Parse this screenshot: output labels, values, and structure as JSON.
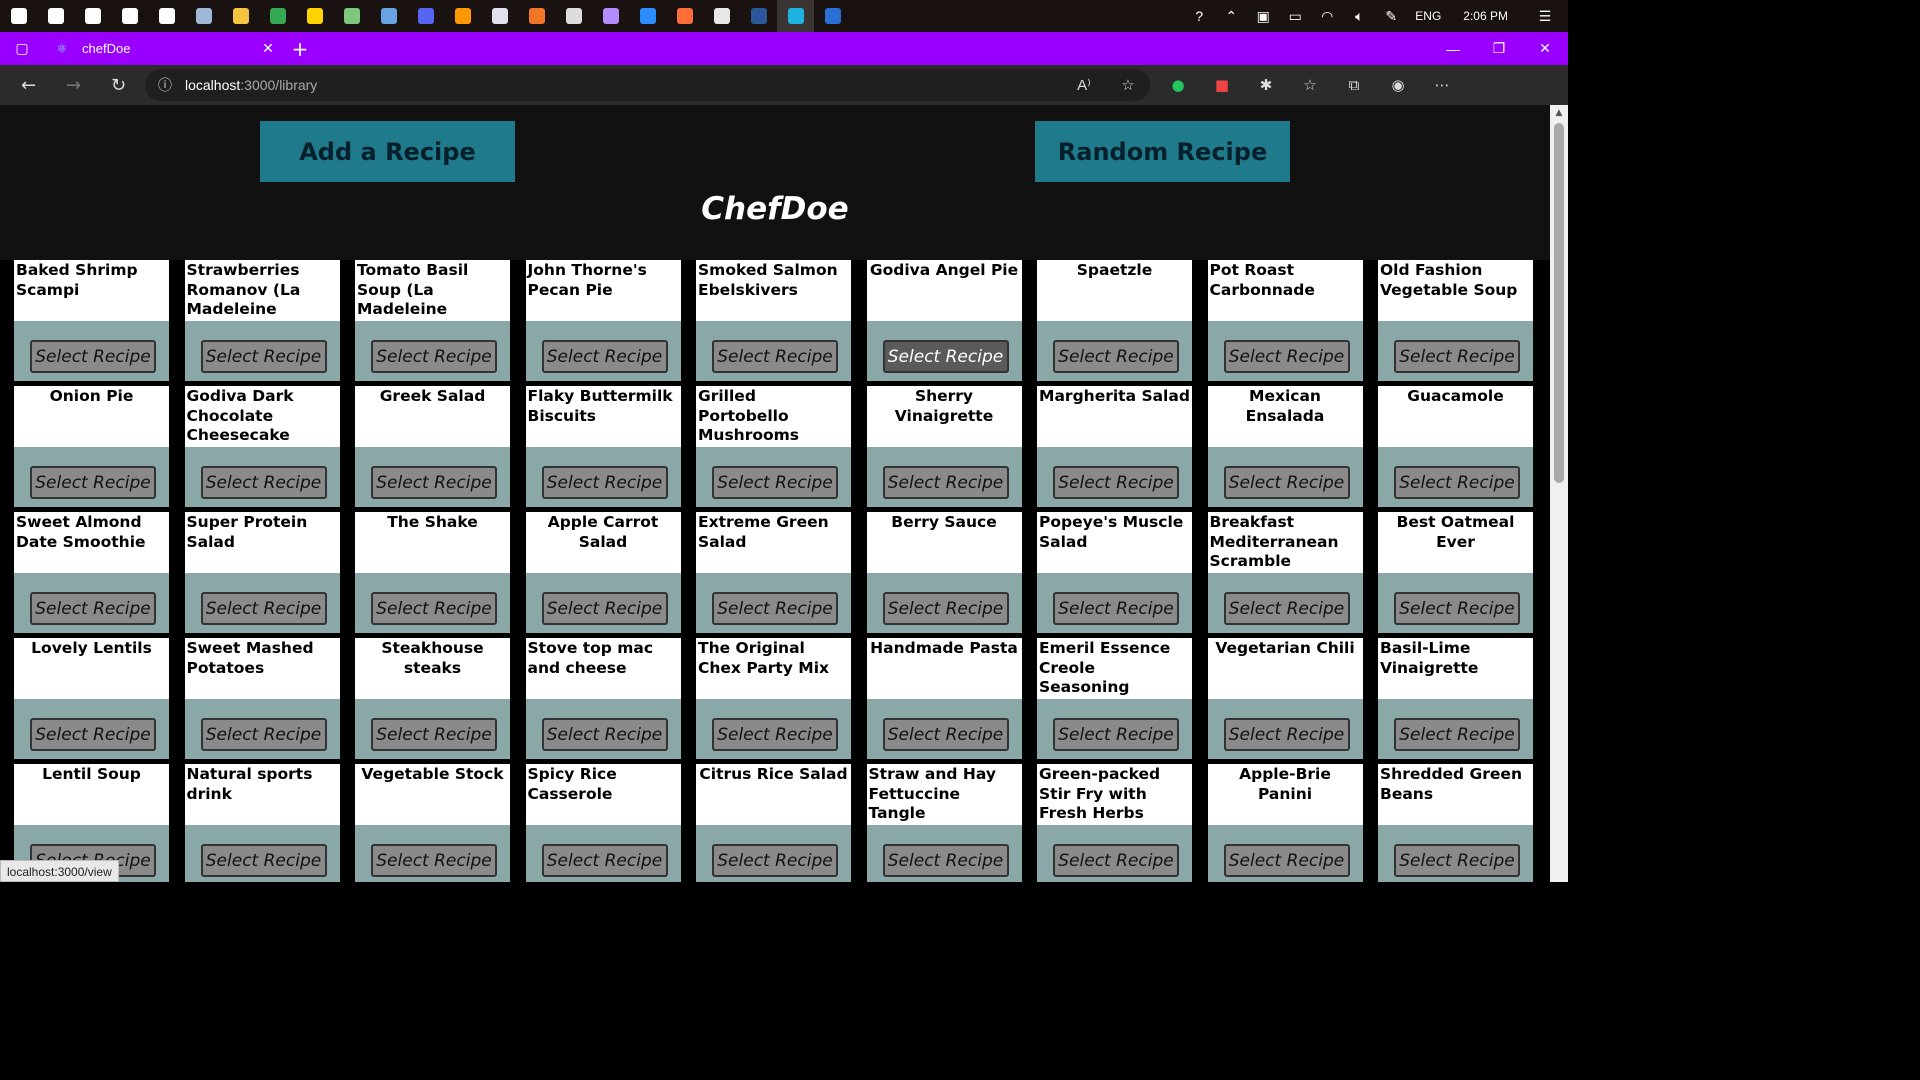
{
  "taskbar": {
    "apps": [
      {
        "name": "windows-start-icon",
        "color": "#ffffff"
      },
      {
        "name": "search-icon",
        "color": "#ffffff"
      },
      {
        "name": "cortana-icon",
        "color": "#ffffff"
      },
      {
        "name": "task-view-icon",
        "color": "#ffffff"
      },
      {
        "name": "settings-gear-icon",
        "color": "#ffffff"
      },
      {
        "name": "photos-icon",
        "color": "#9fb7d8"
      },
      {
        "name": "file-explorer-icon",
        "color": "#f5c542"
      },
      {
        "name": "chrome-icon",
        "color": "#34a853"
      },
      {
        "name": "sticky-notes-icon",
        "color": "#ffd400"
      },
      {
        "name": "notepad-icon",
        "color": "#7fc97f"
      },
      {
        "name": "azure-icon",
        "color": "#6aa2e6"
      },
      {
        "name": "discord-icon",
        "color": "#5865f2"
      },
      {
        "name": "sublime-icon",
        "color": "#ff9800"
      },
      {
        "name": "postman-icon",
        "color": "#e0e0f0"
      },
      {
        "name": "jupyter-icon",
        "color": "#f37626"
      },
      {
        "name": "network-icon",
        "color": "#dddddd"
      },
      {
        "name": "github-icon",
        "color": "#b38cff"
      },
      {
        "name": "zoom-icon",
        "color": "#2d8cff"
      },
      {
        "name": "firefox-dev-icon",
        "color": "#ff6d3b"
      },
      {
        "name": "mysql-icon",
        "color": "#e8e8e8"
      },
      {
        "name": "word-icon",
        "color": "#2b579a"
      },
      {
        "name": "edge-icon",
        "color": "#1fb3e0"
      },
      {
        "name": "powershell-icon",
        "color": "#2a6fd6"
      }
    ],
    "active_index": 21,
    "language": "ENG",
    "time": "2:06 PM"
  },
  "browser": {
    "tab_title": "chefDoe",
    "url_host": "localhost",
    "url_path": ":3000/library",
    "accent": "#9a00ff"
  },
  "page": {
    "add_label": "Add a Recipe",
    "random_label": "Random Recipe",
    "brand": "ChefDoe",
    "button_label": "Select Recipe",
    "recipes": [
      {
        "title": "Baked Shrimp Scampi",
        "align": "left"
      },
      {
        "title": "Strawberries Romanov (La Madeleine copycat)",
        "align": "left"
      },
      {
        "title": "Tomato Basil Soup (La Madeleine copycat)",
        "align": "left"
      },
      {
        "title": "John Thorne's Pecan Pie",
        "align": "left"
      },
      {
        "title": "Smoked Salmon Ebelskivers",
        "align": "left"
      },
      {
        "title": "Godiva Angel Pie",
        "align": "center",
        "hover": true
      },
      {
        "title": "Spaetzle",
        "align": "center"
      },
      {
        "title": "Pot Roast Carbonnade",
        "align": "left"
      },
      {
        "title": "Old Fashion Vegetable Soup",
        "align": "left"
      },
      {
        "title": "Onion Pie",
        "align": "center"
      },
      {
        "title": "Godiva Dark Chocolate Cheesecake",
        "align": "left"
      },
      {
        "title": "Greek Salad",
        "align": "center"
      },
      {
        "title": "Flaky Buttermilk Biscuits",
        "align": "left"
      },
      {
        "title": "Grilled Portobello Mushrooms",
        "align": "left",
        "scroll": true
      },
      {
        "title": "Sherry Vinaigrette",
        "align": "center"
      },
      {
        "title": "Margherita Salad",
        "align": "center"
      },
      {
        "title": "Mexican Ensalada",
        "align": "center"
      },
      {
        "title": "Guacamole",
        "align": "center"
      },
      {
        "title": "Sweet Almond Date Smoothie",
        "align": "left"
      },
      {
        "title": "Super Protein Salad",
        "align": "left"
      },
      {
        "title": "The Shake",
        "align": "center"
      },
      {
        "title": "Apple Carrot Salad",
        "align": "center"
      },
      {
        "title": "Extreme Green Salad",
        "align": "left"
      },
      {
        "title": "Berry Sauce",
        "align": "center"
      },
      {
        "title": "Popeye's Muscle Salad",
        "align": "left"
      },
      {
        "title": "Breakfast Mediterranean Scramble",
        "align": "left"
      },
      {
        "title": "Best Oatmeal Ever",
        "align": "center"
      },
      {
        "title": "Lovely Lentils",
        "align": "center"
      },
      {
        "title": "Sweet Mashed Potatoes",
        "align": "left"
      },
      {
        "title": "Steakhouse steaks",
        "align": "center"
      },
      {
        "title": "Stove top mac and cheese",
        "align": "left"
      },
      {
        "title": "The Original Chex Party Mix",
        "align": "left"
      },
      {
        "title": "Handmade Pasta",
        "align": "center"
      },
      {
        "title": "Emeril Essence Creole Seasoning",
        "align": "left"
      },
      {
        "title": "Vegetarian Chili",
        "align": "center"
      },
      {
        "title": "Basil-Lime Vinaigrette",
        "align": "left"
      },
      {
        "title": "Lentil Soup",
        "align": "center"
      },
      {
        "title": "Natural sports drink",
        "align": "left"
      },
      {
        "title": "Vegetable Stock",
        "align": "center"
      },
      {
        "title": "Spicy Rice Casserole",
        "align": "left"
      },
      {
        "title": "Citrus Rice Salad",
        "align": "center"
      },
      {
        "title": "Straw and Hay Fettuccine Tangle",
        "align": "left"
      },
      {
        "title": "Green-packed Stir Fry with Fresh Herbs",
        "align": "left"
      },
      {
        "title": "Apple-Brie Panini",
        "align": "center"
      },
      {
        "title": "Shredded Green Beans",
        "align": "left"
      }
    ]
  },
  "status_url": "localhost:3000/view"
}
